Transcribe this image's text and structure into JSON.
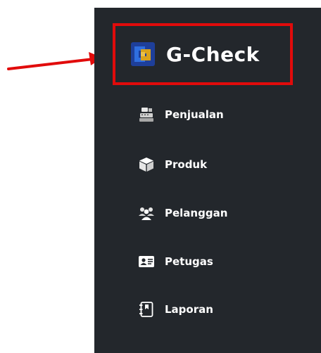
{
  "brand": {
    "name": "G-Check",
    "logo_icon": "g-check-logo-icon",
    "highlight_color": "#e10b0b"
  },
  "annotation": {
    "arrow_color": "#e10b0b"
  },
  "sidebar": {
    "background": "#23272c",
    "items": [
      {
        "label": "Penjualan",
        "icon": "cash-register-icon"
      },
      {
        "label": "Produk",
        "icon": "box-icon"
      },
      {
        "label": "Pelanggan",
        "icon": "users-icon"
      },
      {
        "label": "Petugas",
        "icon": "id-card-icon"
      },
      {
        "label": "Laporan",
        "icon": "book-icon"
      }
    ]
  }
}
